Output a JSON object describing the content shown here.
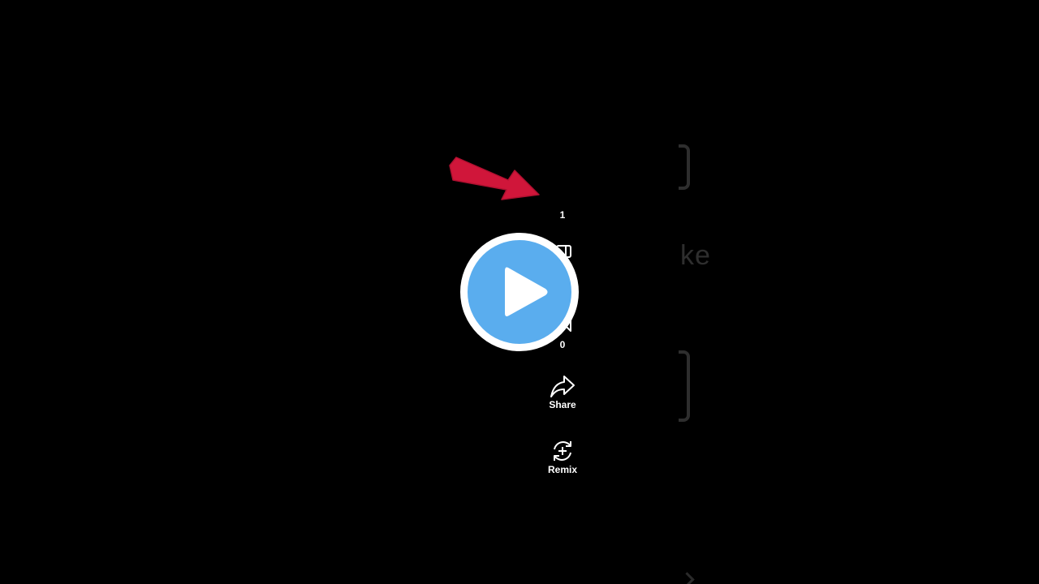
{
  "background": {
    "color": "#000000",
    "faded_text": "ke"
  },
  "annotation": {
    "arrow_color": "#d0163a",
    "arrow_icon": "red-arrow-icon"
  },
  "actions": {
    "like_count": "1",
    "comment_count": "0",
    "share_label": "Share",
    "share_icon": "share-arrow-icon",
    "remix_label": "Remix",
    "remix_icon": "remix-icon"
  },
  "player": {
    "play_icon": "play-icon",
    "ring_color": "#ffffff",
    "fill_color": "#5aadee"
  }
}
